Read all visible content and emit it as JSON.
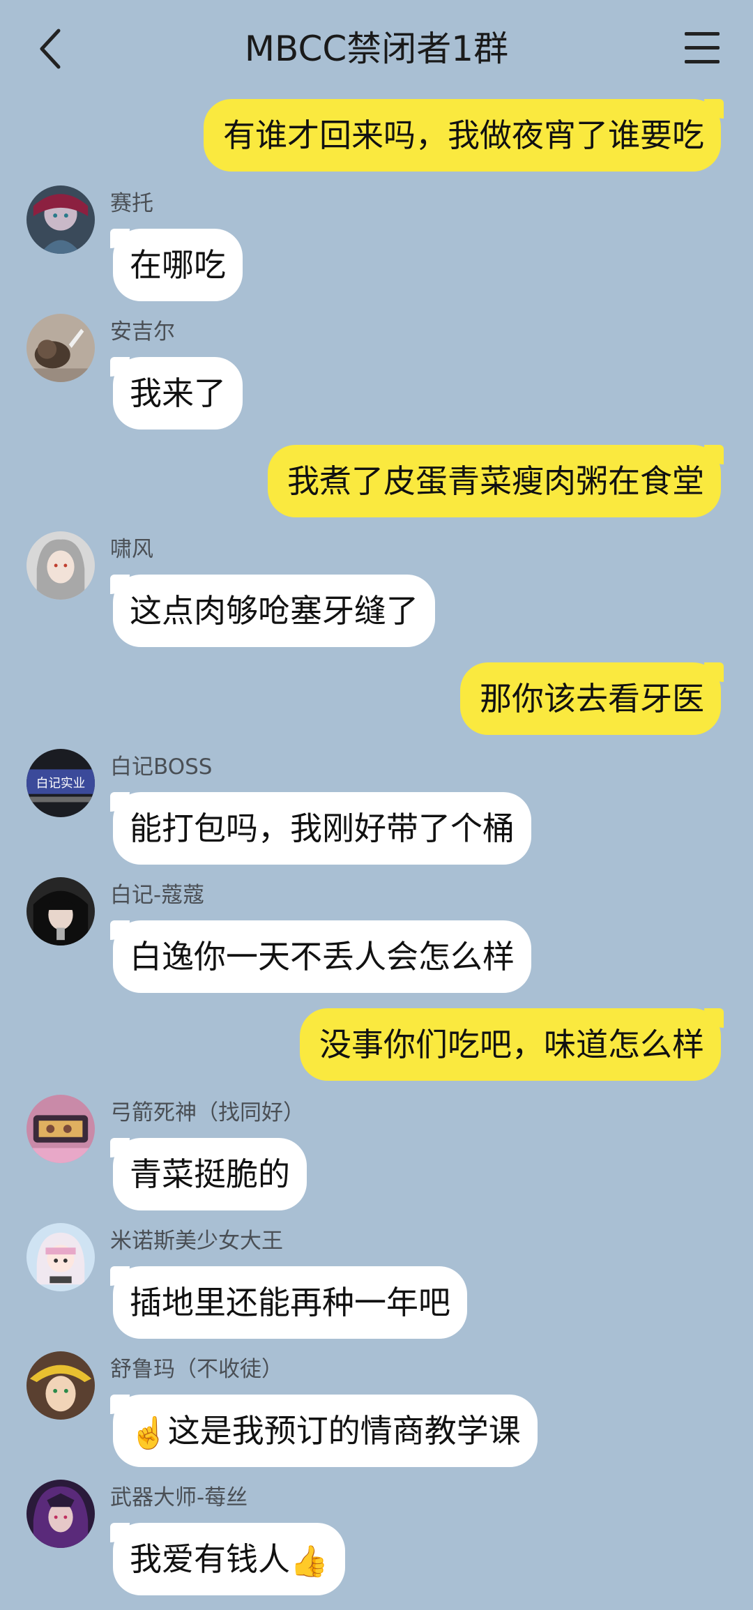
{
  "header": {
    "title": "MBCC禁闭者1群",
    "back_icon": "chevron-left-icon",
    "menu_icon": "hamburger-menu-icon"
  },
  "messages": [
    {
      "side": "mine",
      "text": "有谁才回来吗，我做夜宵了谁要吃"
    },
    {
      "side": "other",
      "sender": "赛托",
      "text": "在哪吃"
    },
    {
      "side": "other",
      "sender": "安吉尔",
      "text": "我来了"
    },
    {
      "side": "mine",
      "text": "我煮了皮蛋青菜瘦肉粥在食堂"
    },
    {
      "side": "other",
      "sender": "啸风",
      "text": "这点肉够呛塞牙缝了"
    },
    {
      "side": "mine",
      "text": "那你该去看牙医"
    },
    {
      "side": "other",
      "sender": "白记BOSS",
      "text": "能打包吗，我刚好带了个桶"
    },
    {
      "side": "other",
      "sender": "白记-蔻蔻",
      "text": "白逸你一天不丢人会怎么样"
    },
    {
      "side": "mine",
      "text": "没事你们吃吧，味道怎么样"
    },
    {
      "side": "other",
      "sender": "弓箭死神（找同好）",
      "text": "青菜挺脆的"
    },
    {
      "side": "other",
      "sender": "米诺斯美少女大王",
      "text": "插地里还能再种一年吧"
    },
    {
      "side": "other",
      "sender": "舒鲁玛（不收徒）",
      "text": "这是我预订的情商教学课",
      "emoji_before": "☝️"
    },
    {
      "side": "other",
      "sender": "武器大师-莓丝",
      "text": "我爱有钱人",
      "emoji_after": "👍"
    }
  ],
  "avatar_badge_text": "白记实业",
  "colors": {
    "background": "#a9bfd3",
    "mine_bubble": "#fae93f",
    "other_bubble": "#ffffff"
  }
}
